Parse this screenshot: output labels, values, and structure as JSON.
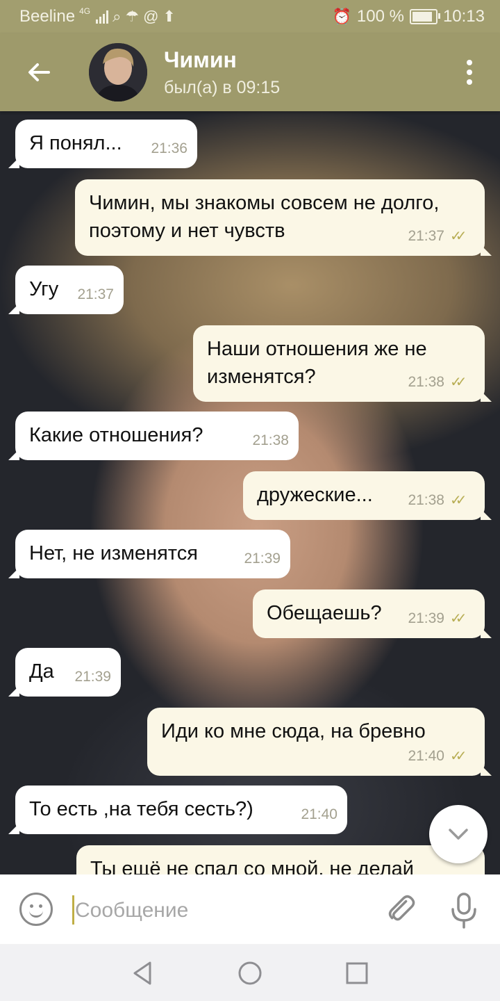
{
  "status_bar": {
    "carrier": "Beeline",
    "network": "4G",
    "battery_text": "100 %",
    "battery_level": 1.0,
    "time": "10:13"
  },
  "header": {
    "contact_name": "Чимин",
    "last_seen": "был(а) в 09:15"
  },
  "messages": [
    {
      "direction": "in",
      "text": "Я понял...",
      "time": "21:36"
    },
    {
      "direction": "out",
      "text": "Чимин, мы знакомы совсем не долго, поэтому и нет чувств",
      "time": "21:37",
      "read": true
    },
    {
      "direction": "in",
      "text": "Угу",
      "time": "21:37"
    },
    {
      "direction": "out",
      "text": "Наши отношения же не изменятся?",
      "time": "21:38",
      "read": true
    },
    {
      "direction": "in",
      "text": "Какие отношения?",
      "time": "21:38"
    },
    {
      "direction": "out",
      "text": "дружеские...",
      "time": "21:38",
      "read": true
    },
    {
      "direction": "in",
      "text": "Нет, не изменятся",
      "time": "21:39"
    },
    {
      "direction": "out",
      "text": "Обещаешь?",
      "time": "21:39",
      "read": true
    },
    {
      "direction": "in",
      "text": "Да",
      "time": "21:39"
    },
    {
      "direction": "out",
      "text": "Иди ко мне сюда, на бревно",
      "time": "21:40",
      "read": true
    },
    {
      "direction": "in",
      "text": "То есть ,на тебя сесть?)",
      "time": "21:40"
    },
    {
      "direction": "out",
      "text": "Ты ещё не спал со мной, не делай",
      "time": "",
      "read": false
    }
  ],
  "composer": {
    "placeholder": "Сообщение"
  },
  "colors": {
    "header": "#9e9a6b",
    "statusbar": "#a29e6f",
    "read_check": "#b8ae55",
    "cursor": "#bfae45"
  },
  "icons": {
    "back": "arrow-left-icon",
    "menu": "more-vertical-icon",
    "emoji": "emoji-icon",
    "attach": "paperclip-icon",
    "mic": "microphone-icon",
    "scroll_down": "chevron-down-icon"
  }
}
